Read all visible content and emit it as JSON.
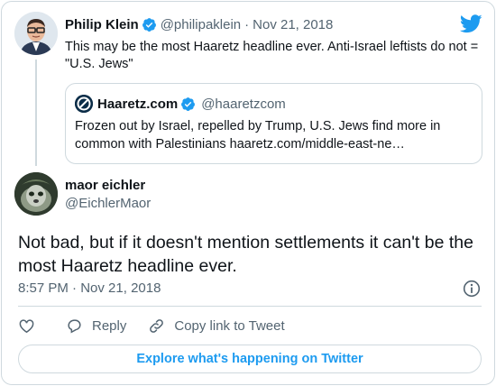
{
  "parent_tweet": {
    "author_name": "Philip Klein",
    "author_handle": "@philipaklein",
    "separator": "·",
    "date": "Nov 21, 2018",
    "text": "This may be the most Haaretz headline ever. Anti-Israel leftists do not = \"U.S. Jews\"",
    "quoted": {
      "author_name": "Haaretz.com",
      "author_handle": "@haaretzcom",
      "text": "Frozen out by Israel, repelled by Trump, U.S. Jews find more in common with Palestinians haaretz.com/middle-east-ne…"
    }
  },
  "main_tweet": {
    "author_name": "maor eichler",
    "author_handle": "@EichlerMaor",
    "text": "Not bad, but if it doesn't mention settlements it can't be the most Haaretz headline ever.",
    "time": "8:57 PM",
    "separator": "·",
    "date": "Nov 21, 2018"
  },
  "actions": {
    "reply_label": "Reply",
    "copy_link_label": "Copy link to Tweet"
  },
  "explore_label": "Explore what's happening on Twitter",
  "icons": {
    "verified": "verified-badge-icon",
    "brand": "twitter-bird-icon",
    "info": "info-icon",
    "like": "heart-icon",
    "reply": "speech-bubble-icon",
    "link": "link-icon"
  },
  "colors": {
    "accent": "#1d9bf0",
    "text": "#0f1419",
    "secondary_text": "#536471",
    "border": "#cfd9de"
  }
}
